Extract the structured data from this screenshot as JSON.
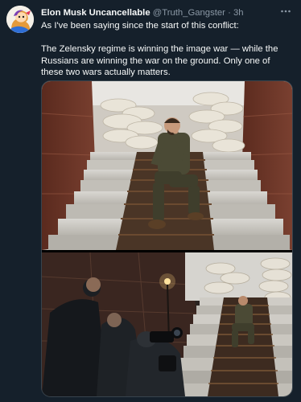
{
  "tweet": {
    "author": {
      "name": "Elon Musk Uncancellable",
      "handle": "@Truth_Gangster",
      "separator": "·",
      "time": "3h",
      "avatar_icon": "avatar-illustration-icon"
    },
    "more_icon": "more-icon",
    "body": {
      "line1": "As I've been saying since the start of this conflict:",
      "line2": "The Zelensky regime is winning the image war — while the Russians are winning the war on the ground. Only one of these two wars actually matters."
    }
  },
  "colors": {
    "background": "#15202b",
    "text": "#f7f9f9",
    "secondary": "#8b98a5",
    "border": "#38444d"
  }
}
